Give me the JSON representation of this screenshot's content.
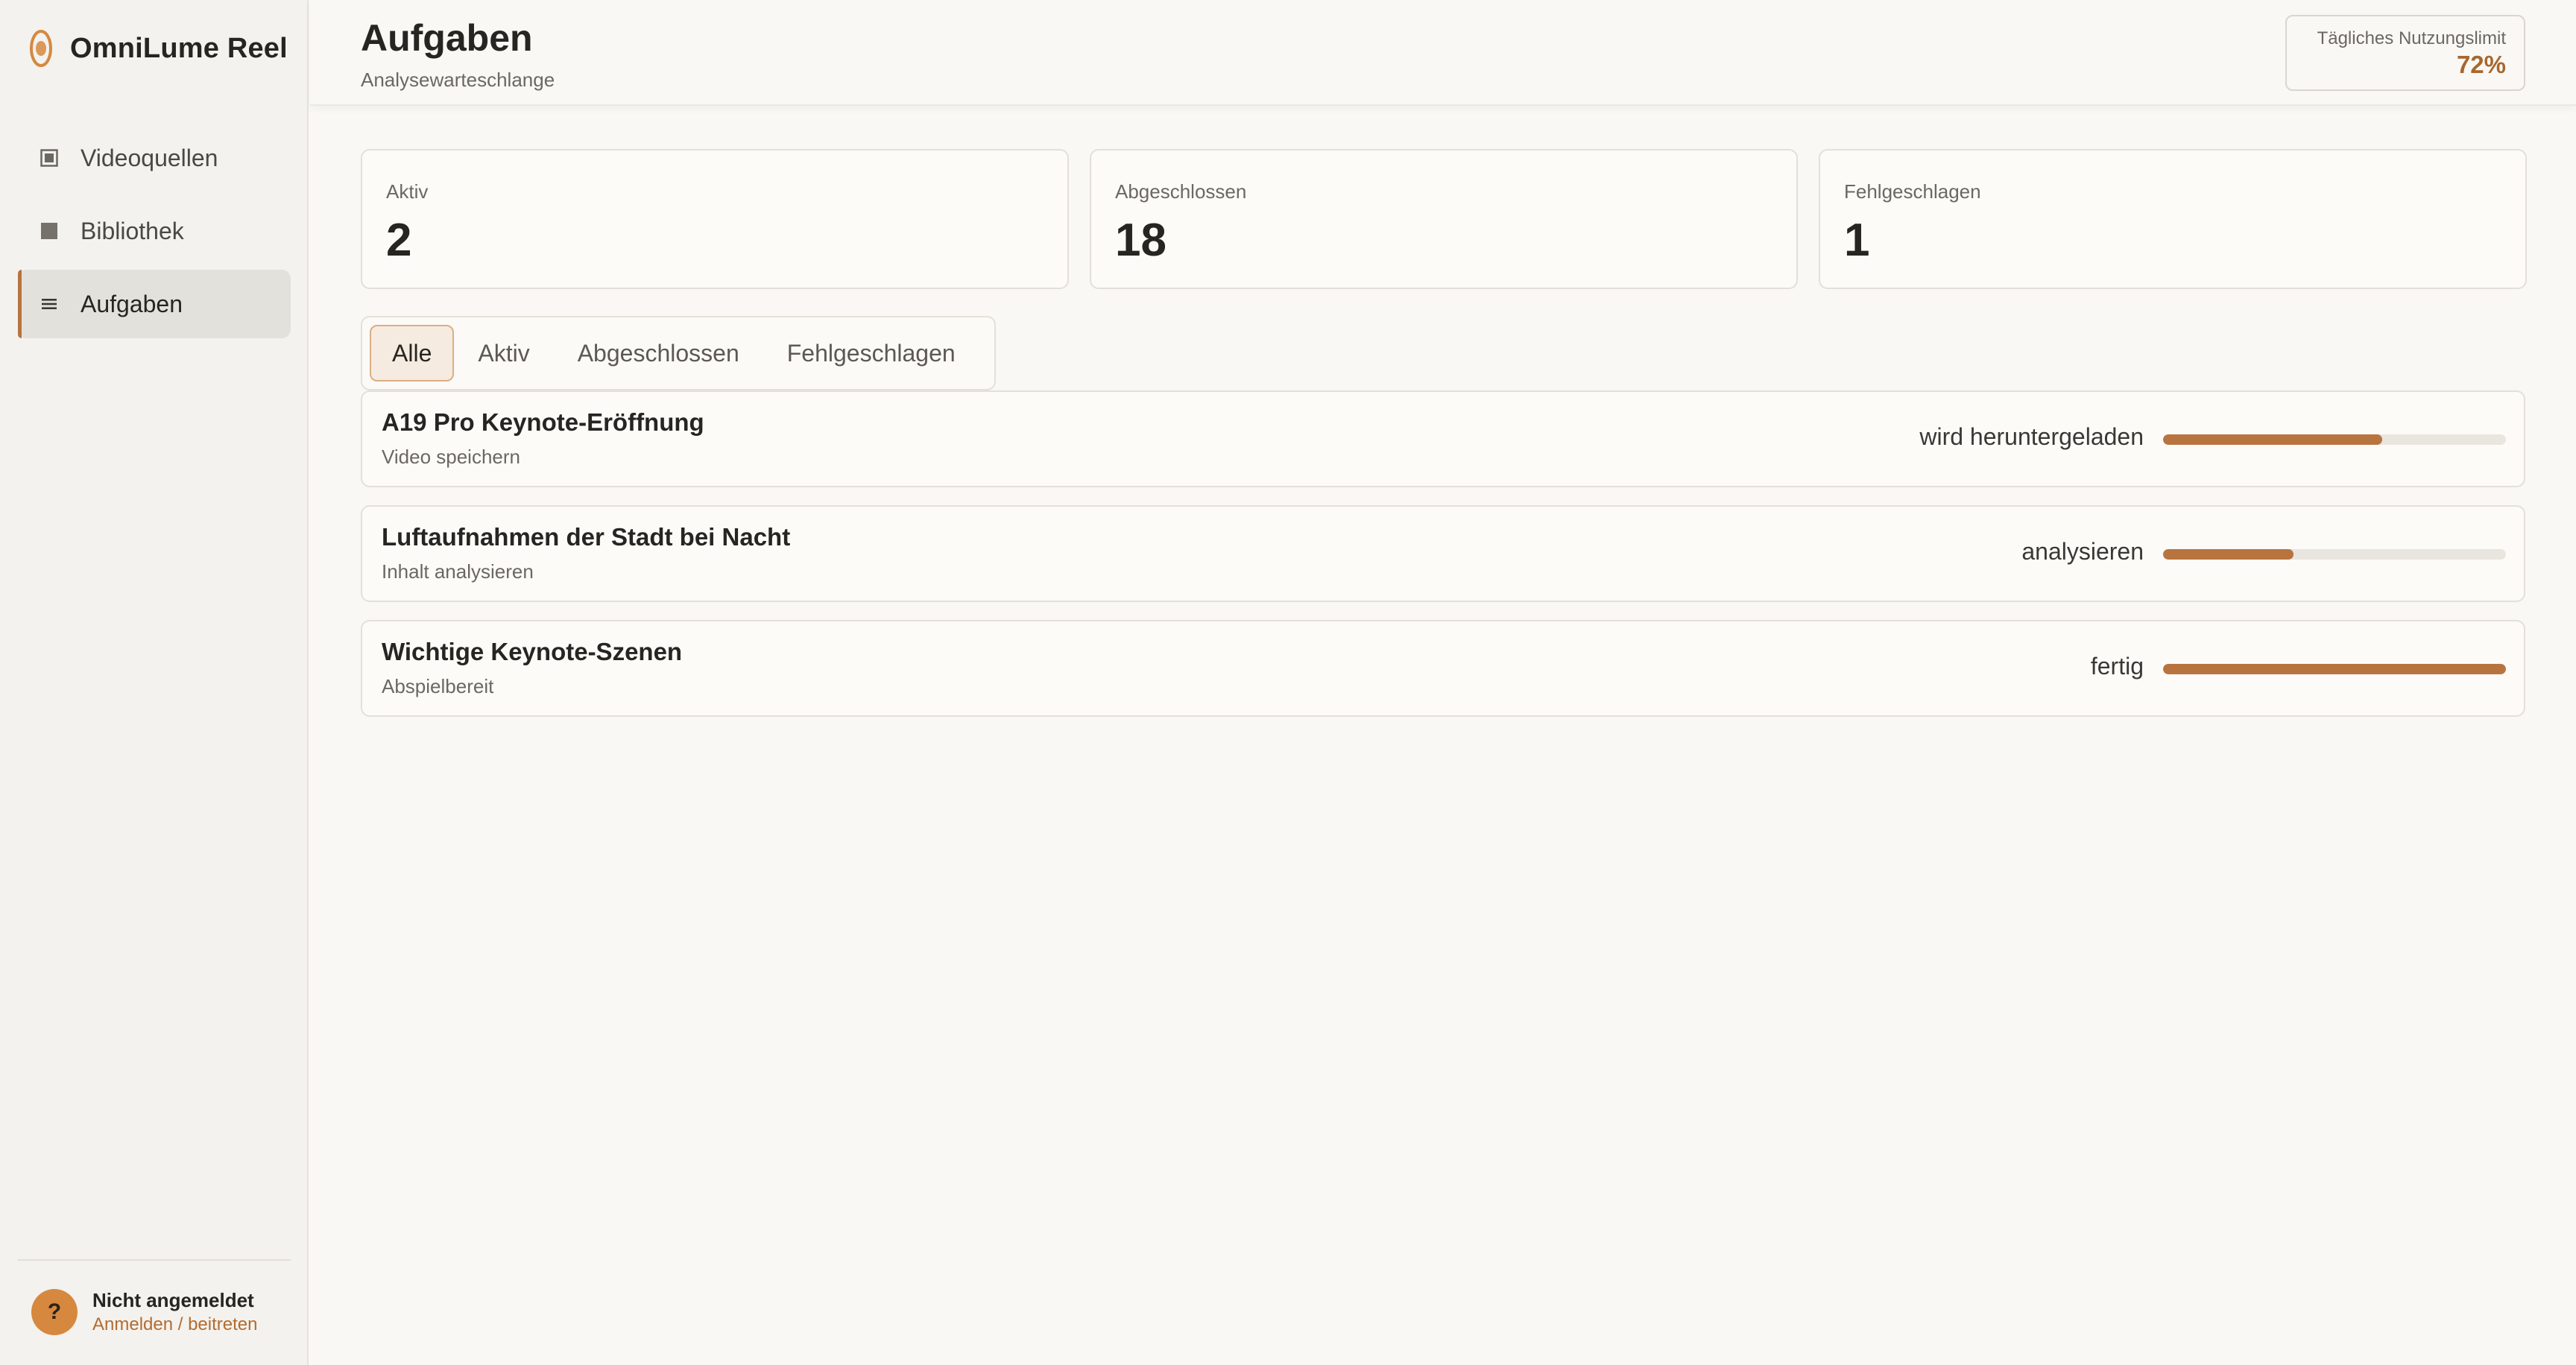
{
  "app": {
    "name": "OmniLume Reel",
    "accent": "#b8743f"
  },
  "sidebar": {
    "items": [
      {
        "label": "Videoquellen",
        "icon": "video-source-icon",
        "active": false
      },
      {
        "label": "Bibliothek",
        "icon": "library-icon",
        "active": false
      },
      {
        "label": "Aufgaben",
        "icon": "list-icon",
        "active": true
      }
    ],
    "user": {
      "avatar_glyph": "?",
      "name": "Nicht angemeldet",
      "link": "Anmelden / beitreten"
    }
  },
  "header": {
    "title": "Aufgaben",
    "subtitle": "Analysewarteschlange",
    "usage": {
      "label": "Tägliches Nutzungslimit",
      "value": "72%"
    }
  },
  "stats": [
    {
      "label": "Aktiv",
      "value": "2"
    },
    {
      "label": "Abgeschlossen",
      "value": "18"
    },
    {
      "label": "Fehlgeschlagen",
      "value": "1"
    }
  ],
  "filters": {
    "tabs": [
      "Alle",
      "Aktiv",
      "Abgeschlossen",
      "Fehlgeschlagen"
    ],
    "selected": "Alle"
  },
  "tasks": [
    {
      "title": "A19 Pro Keynote-Eröffnung",
      "subtitle": "Video speichern",
      "status": "wird heruntergeladen",
      "progress": 0.64
    },
    {
      "title": "Luftaufnahmen der Stadt bei Nacht",
      "subtitle": "Inhalt analysieren",
      "status": "analysieren",
      "progress": 0.38
    },
    {
      "title": "Wichtige Keynote-Szenen",
      "subtitle": "Abspielbereit",
      "status": "fertig",
      "progress": 1.0
    }
  ]
}
